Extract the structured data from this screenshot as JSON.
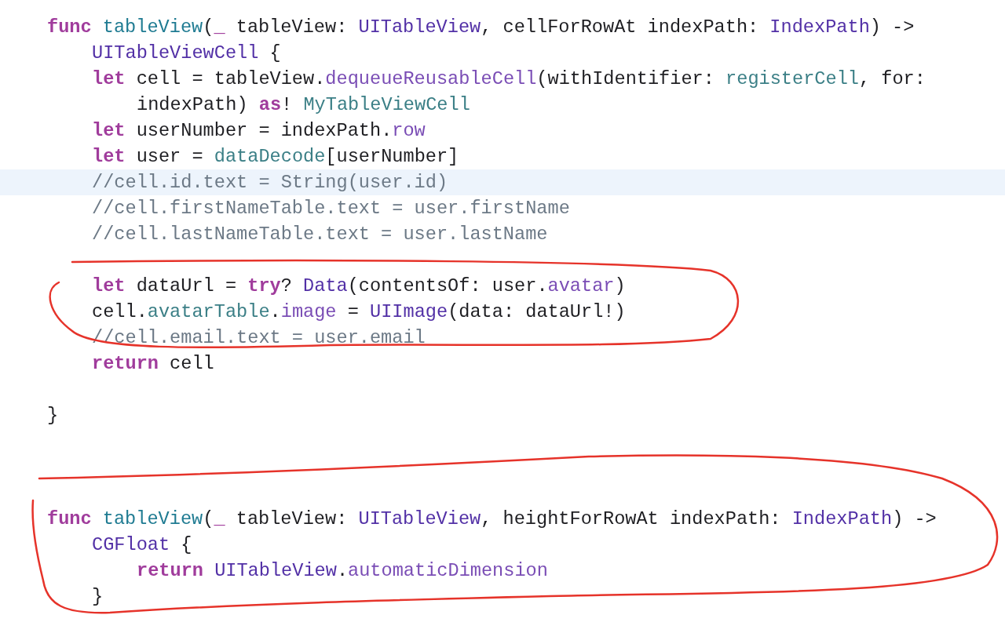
{
  "editor": {
    "lines": [
      {
        "kind": "code",
        "highlighted": false,
        "tokens": [
          {
            "t": "func ",
            "kind": "keyword"
          },
          {
            "t": "tableView",
            "kind": "decl"
          },
          {
            "t": "(",
            "kind": "plain"
          },
          {
            "t": "_",
            "kind": "keyword"
          },
          {
            "t": " tableView: ",
            "kind": "plain"
          },
          {
            "t": "UITableView",
            "kind": "type"
          },
          {
            "t": ", cellForRowAt indexPath: ",
            "kind": "plain"
          },
          {
            "t": "IndexPath",
            "kind": "type"
          },
          {
            "t": ") ->",
            "kind": "plain"
          }
        ],
        "children": [
          {
            "kind": "code",
            "highlighted": false,
            "tokens": [
              {
                "t": "UITableViewCell",
                "kind": "type"
              },
              {
                "t": " {",
                "kind": "plain"
              }
            ]
          },
          {
            "kind": "code",
            "highlighted": false,
            "tokens": [
              {
                "t": "let",
                "kind": "keyword"
              },
              {
                "t": " cell = tableView.",
                "kind": "plain"
              },
              {
                "t": "dequeueReusableCell",
                "kind": "member"
              },
              {
                "t": "(withIdentifier: ",
                "kind": "plain"
              },
              {
                "t": "registerCell",
                "kind": "project"
              },
              {
                "t": ", for:",
                "kind": "plain"
              }
            ],
            "children": [
              {
                "kind": "code",
                "highlighted": false,
                "tokens": [
                  {
                    "t": "indexPath) ",
                    "kind": "plain"
                  },
                  {
                    "t": "as",
                    "kind": "keyword"
                  },
                  {
                    "t": "! ",
                    "kind": "plain"
                  },
                  {
                    "t": "MyTableViewCell",
                    "kind": "project"
                  }
                ]
              }
            ]
          },
          {
            "kind": "code",
            "highlighted": false,
            "tokens": [
              {
                "t": "let",
                "kind": "keyword"
              },
              {
                "t": " userNumber = indexPath.",
                "kind": "plain"
              },
              {
                "t": "row",
                "kind": "member"
              }
            ]
          },
          {
            "kind": "code",
            "highlighted": false,
            "tokens": [
              {
                "t": "let",
                "kind": "keyword"
              },
              {
                "t": " user = ",
                "kind": "plain"
              },
              {
                "t": "dataDecode",
                "kind": "project"
              },
              {
                "t": "[userNumber]",
                "kind": "plain"
              }
            ]
          },
          {
            "kind": "code",
            "highlighted": true,
            "tokens": [
              {
                "t": "//cell.id.text = String(user.id)",
                "kind": "comment"
              }
            ]
          },
          {
            "kind": "code",
            "highlighted": false,
            "tokens": [
              {
                "t": "//cell.firstNameTable.text = user.firstName",
                "kind": "comment"
              }
            ]
          },
          {
            "kind": "code",
            "highlighted": false,
            "tokens": [
              {
                "t": "//cell.lastNameTable.text = user.lastName",
                "kind": "comment"
              }
            ]
          },
          {
            "kind": "blank"
          },
          {
            "kind": "code",
            "highlighted": false,
            "tokens": [
              {
                "t": "let",
                "kind": "keyword"
              },
              {
                "t": " dataUrl = ",
                "kind": "plain"
              },
              {
                "t": "try",
                "kind": "keyword"
              },
              {
                "t": "? ",
                "kind": "plain"
              },
              {
                "t": "Data",
                "kind": "type"
              },
              {
                "t": "(contentsOf: user.",
                "kind": "plain"
              },
              {
                "t": "avatar",
                "kind": "member"
              },
              {
                "t": ")",
                "kind": "plain"
              }
            ]
          },
          {
            "kind": "code",
            "highlighted": false,
            "tokens": [
              {
                "t": "cell.",
                "kind": "plain"
              },
              {
                "t": "avatarTable",
                "kind": "project"
              },
              {
                "t": ".",
                "kind": "plain"
              },
              {
                "t": "image",
                "kind": "member"
              },
              {
                "t": " = ",
                "kind": "plain"
              },
              {
                "t": "UIImage",
                "kind": "type"
              },
              {
                "t": "(data: dataUrl!)",
                "kind": "plain"
              }
            ]
          },
          {
            "kind": "code",
            "highlighted": false,
            "tokens": [
              {
                "t": "//cell.email.text = user.email",
                "kind": "comment"
              }
            ]
          },
          {
            "kind": "code",
            "highlighted": false,
            "tokens": [
              {
                "t": "return",
                "kind": "keyword"
              },
              {
                "t": " cell",
                "kind": "plain"
              }
            ]
          },
          {
            "kind": "blank"
          }
        ]
      },
      {
        "kind": "code",
        "highlighted": false,
        "tokens": [
          {
            "t": "}",
            "kind": "plain"
          }
        ]
      },
      {
        "kind": "blank"
      },
      {
        "kind": "blank"
      },
      {
        "kind": "blank"
      },
      {
        "kind": "code",
        "highlighted": false,
        "tokens": [
          {
            "t": "func ",
            "kind": "keyword"
          },
          {
            "t": "tableView",
            "kind": "decl"
          },
          {
            "t": "(",
            "kind": "plain"
          },
          {
            "t": "_",
            "kind": "keyword"
          },
          {
            "t": " tableView: ",
            "kind": "plain"
          },
          {
            "t": "UITableView",
            "kind": "type"
          },
          {
            "t": ", heightForRowAt indexPath: ",
            "kind": "plain"
          },
          {
            "t": "IndexPath",
            "kind": "type"
          },
          {
            "t": ") ->",
            "kind": "plain"
          }
        ],
        "children": [
          {
            "kind": "code",
            "highlighted": false,
            "tokens": [
              {
                "t": "CGFloat",
                "kind": "type"
              },
              {
                "t": " {",
                "kind": "plain"
              }
            ],
            "children": [
              {
                "kind": "code",
                "highlighted": false,
                "tokens": [
                  {
                    "t": "return ",
                    "kind": "keyword"
                  },
                  {
                    "t": "UITableView",
                    "kind": "type"
                  },
                  {
                    "t": ".",
                    "kind": "plain"
                  },
                  {
                    "t": "automaticDimension",
                    "kind": "member"
                  }
                ]
              }
            ]
          },
          {
            "kind": "code",
            "highlighted": false,
            "tokens": [
              {
                "t": "}",
                "kind": "plain"
              }
            ]
          }
        ]
      }
    ]
  }
}
